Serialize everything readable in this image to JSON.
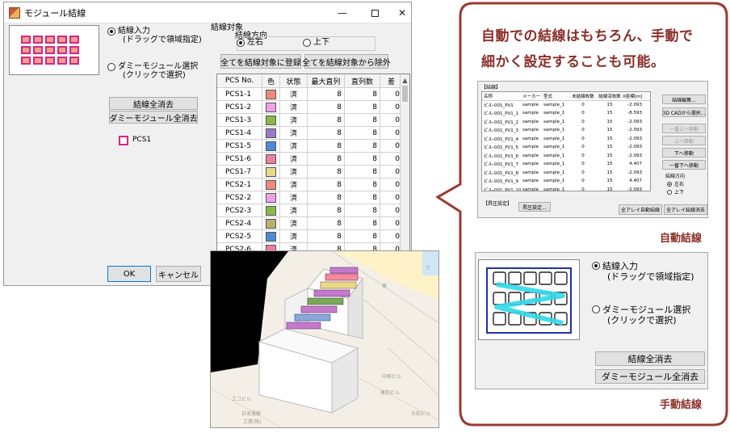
{
  "window": {
    "title": "モジュール結線",
    "option_drag": "結線入力",
    "option_drag_sub": "(ドラッグで領域指定)",
    "option_click": "ダミーモジュール選択",
    "option_click_sub": "(クリックで選択)",
    "clear_wiring": "結線全消去",
    "clear_dummy": "ダミーモジュール全消去",
    "legend_label": "PCS1",
    "ok": "OK",
    "cancel": "キャンセル",
    "target_group": "結線対象",
    "direction_group": "結線方向",
    "dir_lr": "左右",
    "dir_ud": "上下",
    "register_all": "全てを結線対象に登録",
    "exclude_all": "全てを結線対象から除外",
    "table": {
      "headers": [
        "PCS No.",
        "色",
        "状態",
        "最大直列",
        "直列数",
        "差"
      ],
      "rows": [
        {
          "no": "PCS1-1",
          "color": "#f08a78",
          "state": "済",
          "max": "8",
          "count": "8",
          "diff": "0"
        },
        {
          "no": "PCS1-2",
          "color": "#f0a0e8",
          "state": "済",
          "max": "8",
          "count": "8",
          "diff": "0"
        },
        {
          "no": "PCS1-3",
          "color": "#8ab84a",
          "state": "済",
          "max": "8",
          "count": "8",
          "diff": "0"
        },
        {
          "no": "PCS1-4",
          "color": "#9a7ac8",
          "state": "済",
          "max": "8",
          "count": "8",
          "diff": "0"
        },
        {
          "no": "PCS1-5",
          "color": "#4a8ad8",
          "state": "済",
          "max": "8",
          "count": "8",
          "diff": "0"
        },
        {
          "no": "PCS1-6",
          "color": "#f07aa0",
          "state": "済",
          "max": "8",
          "count": "8",
          "diff": "0"
        },
        {
          "no": "PCS1-7",
          "color": "#e8d88a",
          "state": "済",
          "max": "8",
          "count": "8",
          "diff": "0"
        },
        {
          "no": "PCS2-1",
          "color": "#f08a78",
          "state": "済",
          "max": "8",
          "count": "8",
          "diff": "0"
        },
        {
          "no": "PCS2-2",
          "color": "#f0a0e8",
          "state": "済",
          "max": "8",
          "count": "8",
          "diff": "0"
        },
        {
          "no": "PCS2-3",
          "color": "#8ab84a",
          "state": "済",
          "max": "8",
          "count": "8",
          "diff": "0"
        },
        {
          "no": "PCS2-4",
          "color": "#b8b070",
          "state": "済",
          "max": "8",
          "count": "8",
          "diff": "0"
        },
        {
          "no": "PCS2-5",
          "color": "#4a8ad8",
          "state": "済",
          "max": "8",
          "count": "8",
          "diff": "0"
        },
        {
          "no": "PCS2-6",
          "color": "#f07aa0",
          "state": "済",
          "max": "8",
          "count": "8",
          "diff": "0"
        }
      ]
    }
  },
  "callout": {
    "line1": "自動での結線はもちろん、手動で",
    "line2": "細かく設定することも可能。",
    "auto_caption": "自動結線",
    "manual_caption": "手動結線"
  },
  "auto_panel": {
    "group": "【結線】",
    "headers": [
      "名称",
      "メーカー",
      "型式",
      "未結線枚数",
      "結線済枚数",
      "X座標[m]"
    ],
    "rows": [
      {
        "name": "ビル-001_PV1",
        "maker": "sample",
        "model": "sample_1",
        "unwired": "0",
        "wired": "15",
        "x": "-2.093"
      },
      {
        "name": "ビル-001_PV1_1",
        "maker": "sample",
        "model": "sample_1",
        "unwired": "0",
        "wired": "15",
        "x": "-8.593"
      },
      {
        "name": "ビル-001_PV1_2",
        "maker": "sample",
        "model": "sample_1",
        "unwired": "0",
        "wired": "15",
        "x": "-2.093"
      },
      {
        "name": "ビル-001_PV1_3",
        "maker": "sample",
        "model": "sample_1",
        "unwired": "0",
        "wired": "15",
        "x": "-2.093"
      },
      {
        "name": "ビル-001_PV1_4",
        "maker": "sample",
        "model": "sample_1",
        "unwired": "0",
        "wired": "15",
        "x": "-2.093"
      },
      {
        "name": "ビル-001_PV1_5",
        "maker": "sample",
        "model": "sample_1",
        "unwired": "0",
        "wired": "15",
        "x": "-2.093"
      },
      {
        "name": "ビル-001_PV1_6",
        "maker": "sample",
        "model": "sample_1",
        "unwired": "0",
        "wired": "15",
        "x": "-2.093"
      },
      {
        "name": "ビル-001_PV1_7",
        "maker": "sample",
        "model": "sample_1",
        "unwired": "0",
        "wired": "15",
        "x": "4.407"
      },
      {
        "name": "ビル-001_PV1_8",
        "maker": "sample",
        "model": "sample_1",
        "unwired": "0",
        "wired": "15",
        "x": "-2.093"
      },
      {
        "name": "ビル-001_PV1_9",
        "maker": "sample",
        "model": "sample_1",
        "unwired": "0",
        "wired": "15",
        "x": "4.407"
      },
      {
        "name": "ビル-001_PV1_10",
        "maker": "sample",
        "model": "sample_1",
        "unwired": "0",
        "wired": "15",
        "x": "-2.093"
      }
    ],
    "btn_edit": "結線編集...",
    "btn_3dcad": "3D CADから選択...",
    "btn_top": "一番上へ移動",
    "btn_up": "上へ移動",
    "btn_down": "下へ移動",
    "btn_bottom": "一番下へ移動",
    "dir_group": "結線方向",
    "dir_lr": "左右",
    "dir_ud": "上下",
    "boost_group": "【昇圧設定】",
    "btn_boost": "昇圧設定...",
    "btn_auto_all": "全アレイ自動結線",
    "btn_clear_all": "全アレイ結線消去"
  },
  "manual_panel": {
    "option_drag": "結線入力",
    "option_drag_sub": "(ドラッグで領域指定)",
    "option_click": "ダミーモジュール選択",
    "option_click_sub": "(クリックで選択)",
    "clear_wiring": "結線全消去",
    "clear_dummy": "ダミーモジュール全消去"
  },
  "map_labels": [
    "東",
    "中郵ビル",
    "東邦ビル",
    "ア",
    "光和ビル",
    "エコビル",
    "日本運輸",
    "工業(株)"
  ]
}
